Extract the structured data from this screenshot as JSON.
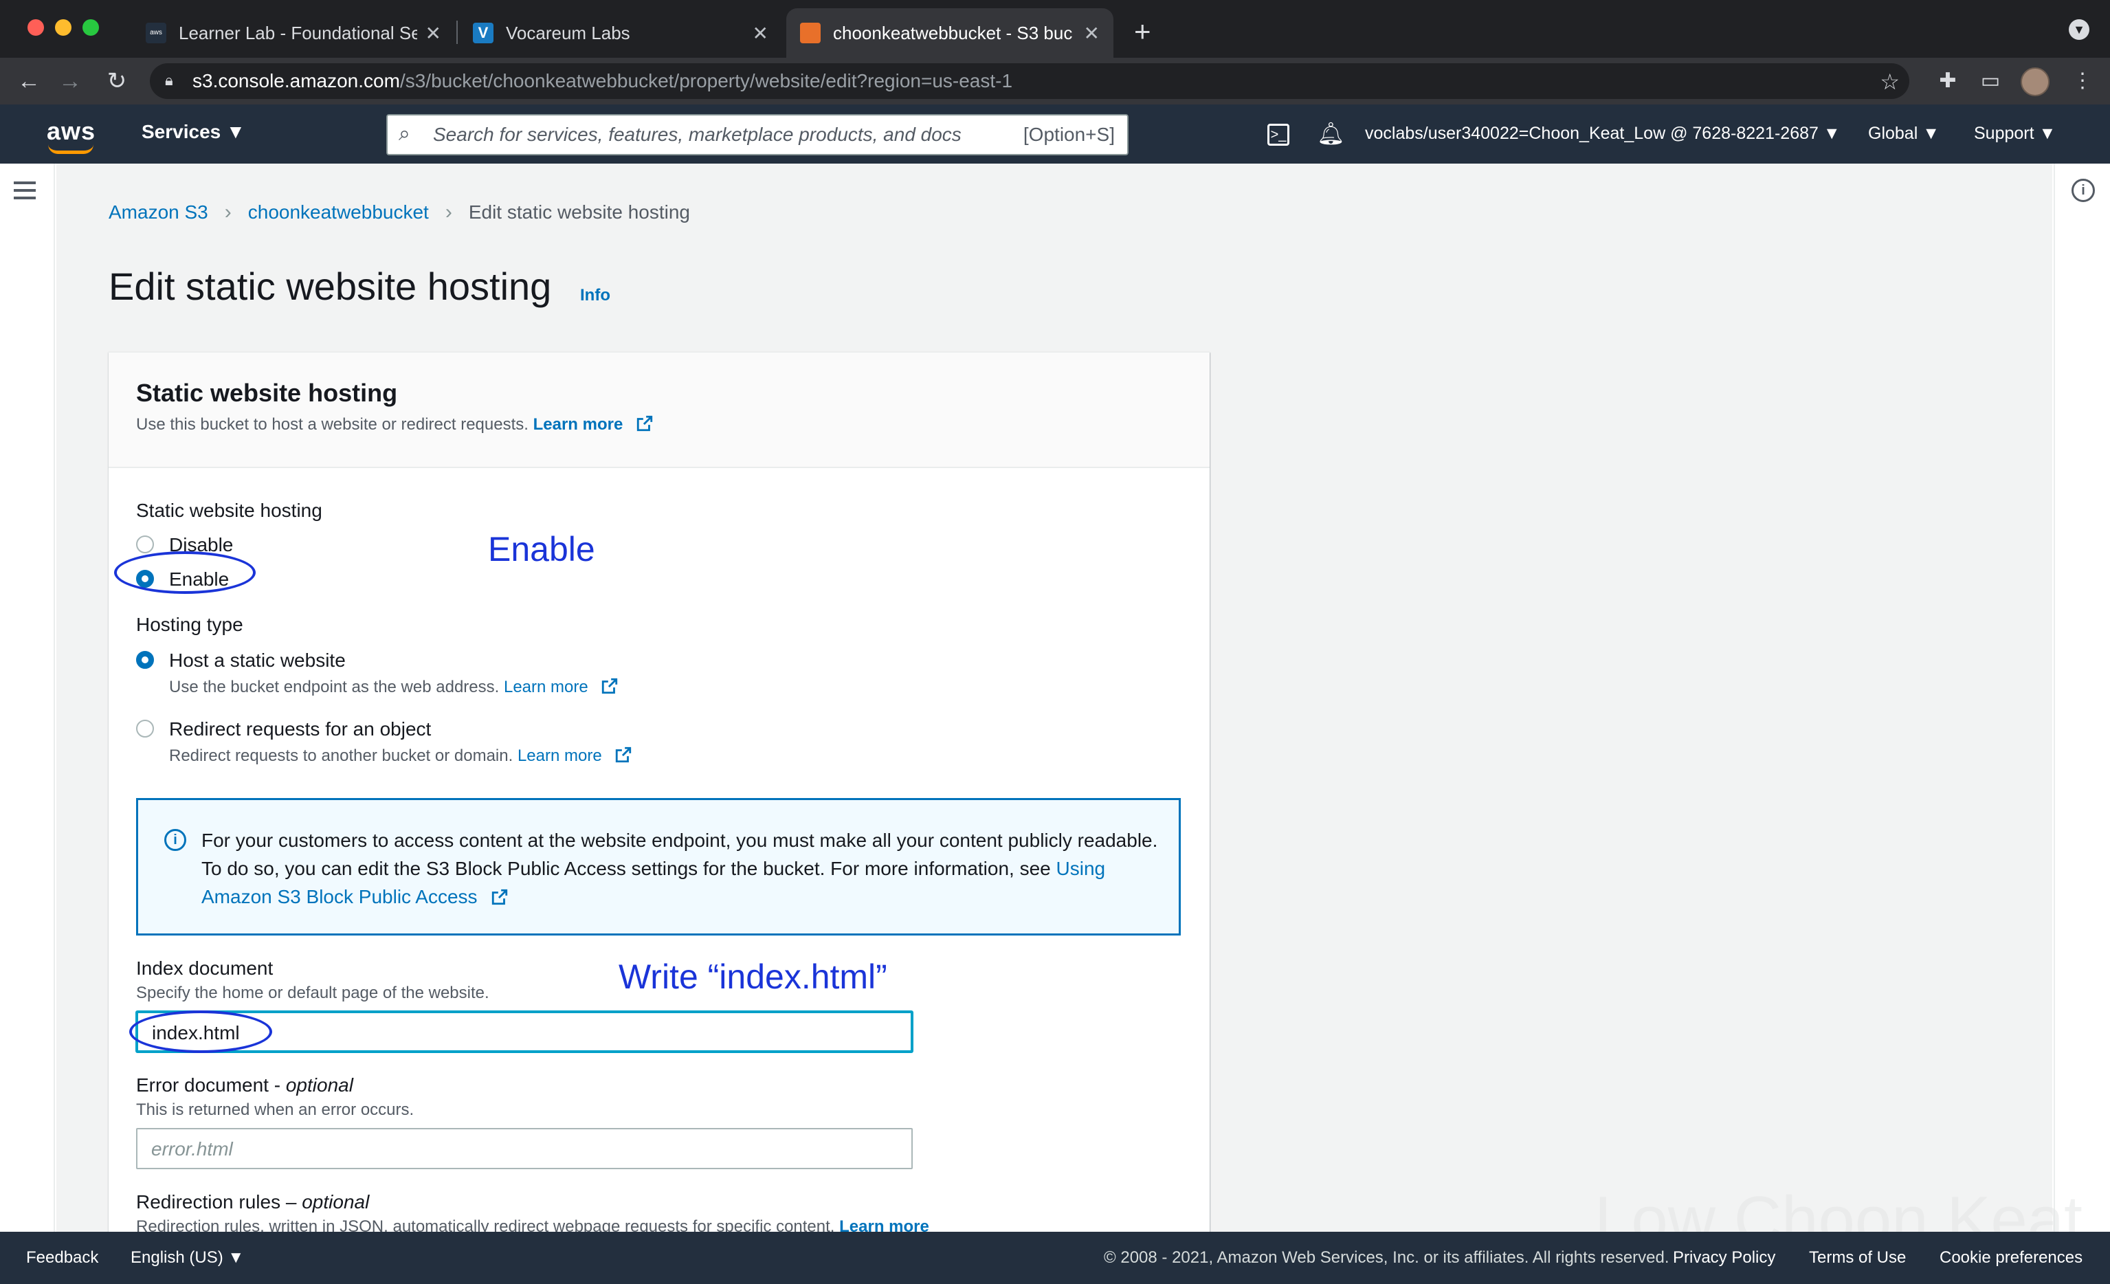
{
  "browser": {
    "tabs": [
      {
        "title": "Learner Lab - Foundational Ser",
        "favicon": "aws-favicon",
        "active": false
      },
      {
        "title": "Vocareum Labs",
        "favicon": "vocareum-favicon",
        "active": false
      },
      {
        "title": "choonkeatwebbucket - S3 buc",
        "favicon": "s3-favicon",
        "active": true
      }
    ],
    "url_host": "s3.console.amazon.com",
    "url_path": "/s3/bucket/choonkeatwebbucket/property/website/edit?region=us-east-1"
  },
  "aws_header": {
    "logo": "aws",
    "services_label": "Services",
    "search_placeholder": "Search for services, features, marketplace products, and docs",
    "search_shortcut": "[Option+S]",
    "account": "voclabs/user340022=Choon_Keat_Low @ 7628-8221-2687",
    "region": "Global",
    "support": "Support"
  },
  "breadcrumb": {
    "root": "Amazon S3",
    "bucket": "choonkeatwebbucket",
    "current": "Edit static website hosting"
  },
  "page": {
    "title": "Edit static website hosting",
    "info": "Info"
  },
  "panel": {
    "title": "Static website hosting",
    "description": "Use this bucket to host a website or redirect requests.",
    "learn_more": "Learn more",
    "hosting_label": "Static website hosting",
    "option_disable": "Disable",
    "option_enable": "Enable",
    "hosting_type_label": "Hosting type",
    "type_static": "Host a static website",
    "type_static_desc": "Use the bucket endpoint as the web address.",
    "type_redirect": "Redirect requests for an object",
    "type_redirect_desc": "Redirect requests to another bucket or domain.",
    "alert_text": "For your customers to access content at the website endpoint, you must make all your content publicly readable. To do so, you can edit the S3 Block Public Access settings for the bucket. For more information, see",
    "alert_link": "Using Amazon S3 Block Public Access",
    "index_label": "Index document",
    "index_desc": "Specify the home or default page of the website.",
    "index_value": "index.html",
    "error_label": "Error document - ",
    "error_optional": "optional",
    "error_desc": "This is returned when an error occurs.",
    "error_placeholder": "error.html",
    "redirect_rules_label": "Redirection rules – ",
    "redirect_rules_optional": "optional",
    "redirect_rules_desc": "Redirection rules, written in JSON, automatically redirect webpage requests for specific content."
  },
  "annotations": {
    "enable_note": "Enable",
    "index_note": "Write “index.html”"
  },
  "watermark": "Low Choon Keat",
  "footer": {
    "feedback": "Feedback",
    "language": "English (US)",
    "copyright": "© 2008 - 2021, Amazon Web Services, Inc. or its affiliates. All rights reserved.",
    "privacy": "Privacy Policy",
    "terms": "Terms of Use",
    "cookies": "Cookie preferences"
  },
  "colors": {
    "aws_nav": "#232f3e",
    "link": "#0073bb",
    "annotation": "#1a34d8"
  }
}
